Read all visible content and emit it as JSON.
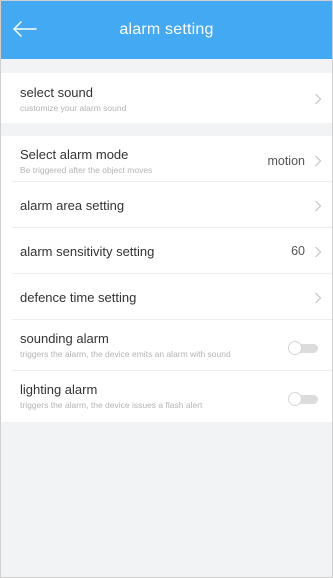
{
  "header": {
    "title": "alarm setting",
    "back_icon": "back-arrow-icon",
    "color": "#44a9f3"
  },
  "sound": {
    "label": "select sound",
    "sublabel": "customize your alarm sound"
  },
  "settings": {
    "alarm_mode": {
      "label": "Select alarm mode",
      "sublabel": "Be triggered after the object moves",
      "value": "motion"
    },
    "alarm_area": {
      "label": "alarm area setting"
    },
    "sensitivity": {
      "label": "alarm sensitivity setting",
      "value": "60"
    },
    "defence_time": {
      "label": "defence time setting"
    },
    "sounding_alarm": {
      "label": "sounding alarm",
      "sublabel": "triggers the alarm, the device emits an alarm with sound",
      "enabled": false
    },
    "lighting_alarm": {
      "label": "lighting alarm",
      "sublabel": "triggers the alarm, the device issues a flash alert",
      "enabled": false
    }
  }
}
